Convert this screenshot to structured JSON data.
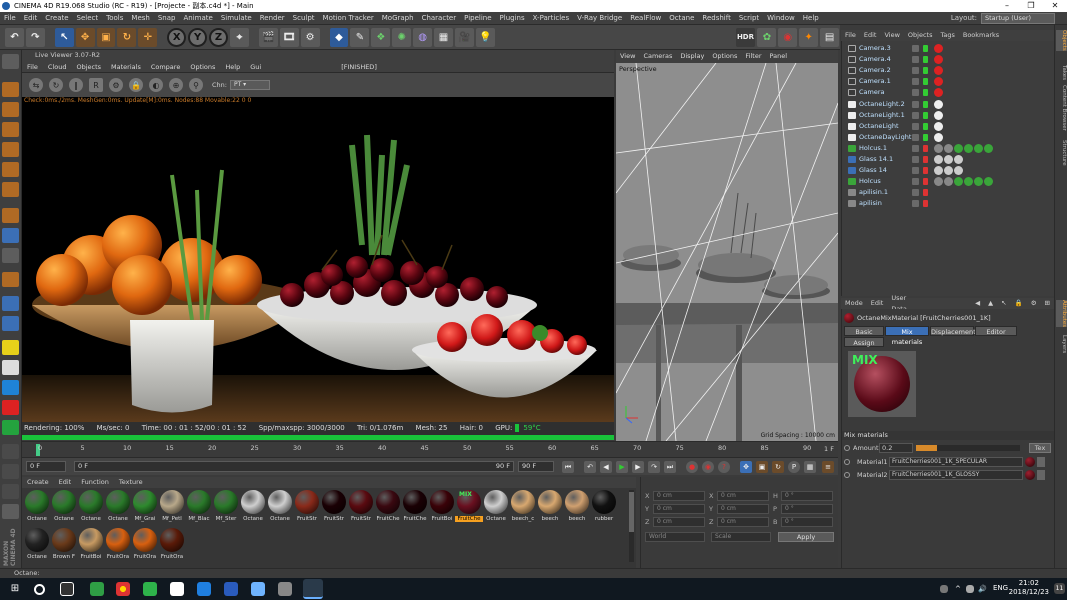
{
  "window": {
    "title": "CINEMA 4D R19.068 Studio (RC - R19) - [Projecte - 副本.c4d *] - Main",
    "min": "–",
    "max": "❐",
    "close": "✕"
  },
  "menu": [
    "File",
    "Edit",
    "Create",
    "Select",
    "Tools",
    "Mesh",
    "Snap",
    "Animate",
    "Simulate",
    "Render",
    "Sculpt",
    "Motion Tracker",
    "MoGraph",
    "Character",
    "Pipeline",
    "Plugins",
    "X-Particles",
    "V-Ray Bridge",
    "RealFlow",
    "Octane",
    "Redshift",
    "Script",
    "Window",
    "Help"
  ],
  "layout": {
    "label": "Layout:",
    "value": "Startup (User)"
  },
  "toolbar": {
    "x": "X",
    "y": "Y",
    "z": "Z",
    "hdr": "HDR"
  },
  "liveviewer": {
    "title": "Live Viewer 3.07-R2",
    "menu": [
      "File",
      "Cloud",
      "Objects",
      "Materials",
      "Compare",
      "Options",
      "Help",
      "Gui"
    ],
    "finished": "[FINISHED]",
    "chn_label": "Chn:",
    "chn_value": "PT",
    "status": "Check:0ms./2ms. MeshGen:0ms. Update[M]:0ms. Nodes:88 Movable:22  0 0",
    "render_bar": {
      "rendering": "Rendering: 100%",
      "mssec": "Ms/sec: 0",
      "time": "Time: 00 : 01 : 52/00 : 01 : 52",
      "spp": "Spp/maxspp: 3000/3000",
      "tri": "Tri: 0/1.076m",
      "mesh": "Mesh: 25",
      "hair": "Hair: 0",
      "gpu": "GPU:",
      "temp": "59°C"
    },
    "progress": 1.0
  },
  "viewport": {
    "menu": [
      "View",
      "Cameras",
      "Display",
      "Options",
      "Filter",
      "Panel"
    ],
    "label": "Perspective",
    "grid": "Grid Spacing : 10000 cm"
  },
  "timeline": {
    "ticks": [
      "0",
      "5",
      "10",
      "15",
      "20",
      "25",
      "30",
      "35",
      "40",
      "45",
      "50",
      "55",
      "60",
      "65",
      "70",
      "75",
      "80",
      "85",
      "90"
    ],
    "end_frame": "1 F",
    "start_field": "0 F",
    "min_field": "0 F",
    "max_field": "90 F",
    "slider_end": "90 F"
  },
  "materials": {
    "menu": [
      "Create",
      "Edit",
      "Function",
      "Texture"
    ],
    "row1": [
      "Octane",
      "Octane",
      "Octane",
      "Octane",
      "Mf_Grai",
      "Mf_Petl",
      "Mf_Blac",
      "Mf_Ster",
      "Octane",
      "Octane",
      "FruitStr",
      "FruitStr",
      "FruitStr",
      "FruitChe",
      "FruitChe",
      "FruitBoi",
      "FruitChe",
      "Octane",
      "beech_c",
      "beech",
      "beech",
      "rubber"
    ],
    "row2": [
      "Octane",
      "Brown F",
      "FruitBoi",
      "FruitOra",
      "FruitOra",
      "FruitOra"
    ],
    "mix_label": "MIX"
  },
  "coords": {
    "x": "X",
    "y": "Y",
    "z": "Z",
    "h": "H",
    "p": "P",
    "b": "B",
    "zero": "0 cm",
    "zero_deg": "0 °",
    "world": "World",
    "scale": "Scale",
    "apply": "Apply"
  },
  "objects": {
    "menu": [
      "File",
      "Edit",
      "View",
      "Objects",
      "Tags",
      "Bookmarks"
    ],
    "items": [
      "Camera.3",
      "Camera.4",
      "Camera.2",
      "Camera.1",
      "Camera",
      "OctaneLight.2",
      "OctaneLight.1",
      "OctaneLight",
      "OctaneDayLight",
      "Holcus.1",
      "Glass 14.1",
      "Glass 14",
      "Holcus",
      "apilisin.1",
      "apilisin"
    ]
  },
  "attributes": {
    "menu": [
      "Mode",
      "Edit",
      "User Data"
    ],
    "material_name": "OctaneMixMaterial [FruitCherries001_1K]",
    "tabs": [
      "Basic",
      "Mix materials",
      "Displacement",
      "Editor",
      "Assign"
    ],
    "preview_label": "MIX",
    "section": "Mix materials",
    "amount_label": "Amount",
    "amount_value": "0.2",
    "amount_fraction": 0.2,
    "tex_label": "Tex",
    "mat1_label": "Material1",
    "mat1_value": "FruitCherries001_1K_SPECULAR",
    "mat2_label": "Material2",
    "mat2_value": "FruitCherries001_1K_GLOSSY"
  },
  "right_tabs": [
    "Objects",
    "Takes",
    "Content Browser",
    "Structure",
    "Attributes",
    "Layers"
  ],
  "status_bar": "Octane:",
  "taskbar": {
    "lang": "ENG",
    "time": "21:02",
    "date": "2018/12/23",
    "notif": "11"
  }
}
